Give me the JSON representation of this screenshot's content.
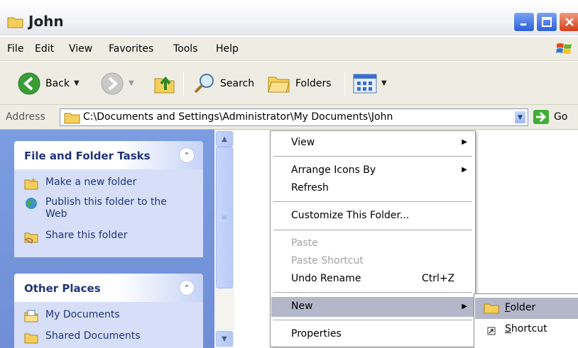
{
  "window": {
    "title": "John"
  },
  "menubar": {
    "items": [
      "File",
      "Edit",
      "View",
      "Favorites",
      "Tools",
      "Help"
    ]
  },
  "toolbar": {
    "back_label": "Back",
    "search_label": "Search",
    "folders_label": "Folders"
  },
  "address": {
    "label": "Address",
    "path": "C:\\Documents and Settings\\Administrator\\My Documents\\John",
    "go_label": "Go"
  },
  "tasks_panel": {
    "title": "File and Folder Tasks",
    "items": [
      "Make a new folder",
      "Publish this folder to the Web",
      "Share this folder"
    ]
  },
  "places_panel": {
    "title": "Other Places",
    "items": [
      "My Documents",
      "Shared Documents"
    ]
  },
  "context_menu": {
    "view": "View",
    "arrange": "Arrange Icons By",
    "refresh": "Refresh",
    "customize": "Customize This Folder...",
    "paste": "Paste",
    "paste_shortcut": "Paste Shortcut",
    "undo": "Undo Rename",
    "undo_shortcut": "Ctrl+Z",
    "new": "New",
    "properties": "Properties"
  },
  "new_submenu": {
    "folder_accel": "F",
    "folder_rest": "older",
    "shortcut_accel": "S",
    "shortcut_rest": "hortcut"
  },
  "colors": {
    "taskpane": "#7b9de0",
    "highlight": "#b3b7c9",
    "panel_title": "#21347a"
  }
}
